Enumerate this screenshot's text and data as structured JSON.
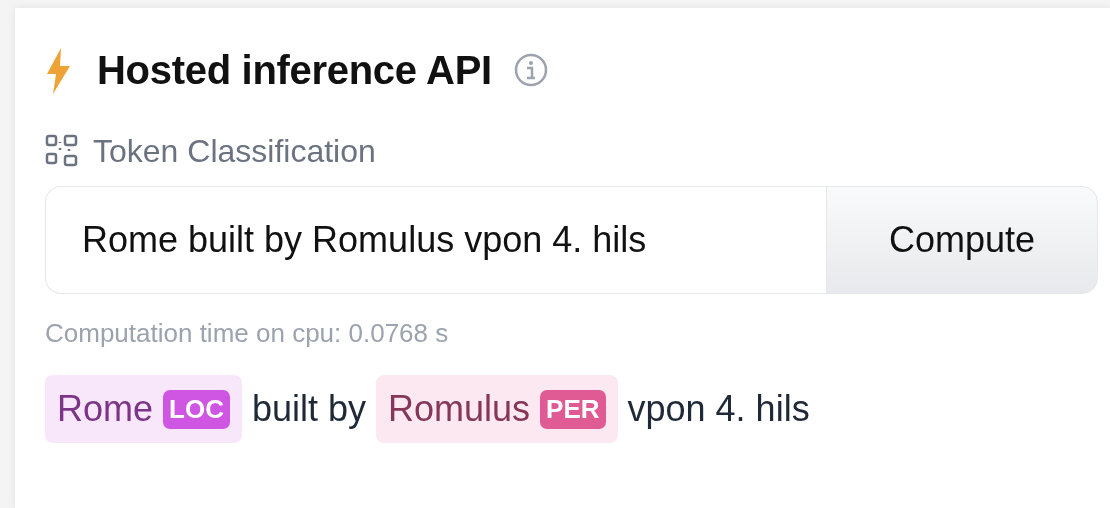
{
  "widget": {
    "title": "Hosted inference API",
    "task": "Token Classification",
    "input": {
      "value": "Rome built by Romulus vpon 4. hils"
    },
    "button": "Compute",
    "timing": "Computation time on cpu: 0.0768 s",
    "output": [
      {
        "kind": "entity",
        "text": "Rome",
        "label": "LOC",
        "color": "#cf55e3"
      },
      {
        "kind": "plain",
        "text": "built by"
      },
      {
        "kind": "entity",
        "text": "Romulus",
        "label": "PER",
        "color": "#e05a94"
      },
      {
        "kind": "plain",
        "text": "vpon 4. hils"
      }
    ]
  }
}
